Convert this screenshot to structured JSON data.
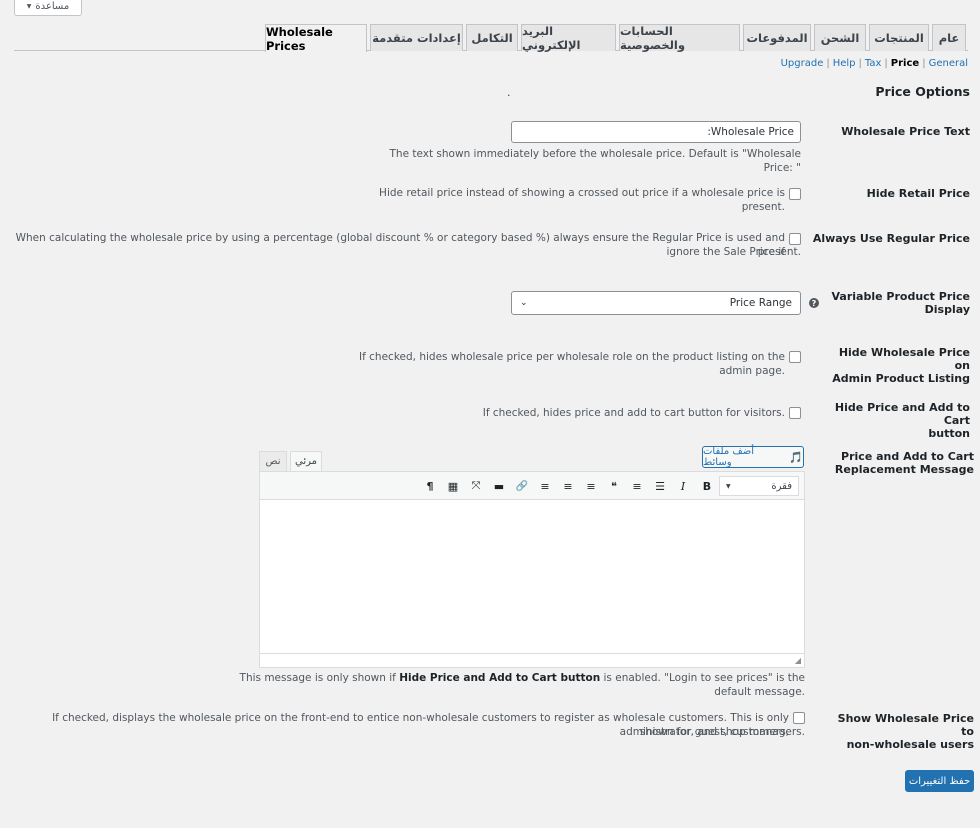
{
  "help": {
    "label": "مساعدة",
    "arrow": "▼"
  },
  "tabs": [
    {
      "label": "عام"
    },
    {
      "label": "المنتجات"
    },
    {
      "label": "الشحن"
    },
    {
      "label": "المدفوعات"
    },
    {
      "label": "الحسابات والخصوصية"
    },
    {
      "label": "البريد الإلكتروني"
    },
    {
      "label": "التكامل"
    },
    {
      "label": "إعدادات متقدمة"
    },
    {
      "label": "Wholesale Prices"
    }
  ],
  "subnav": {
    "general": "General",
    "price": "Price",
    "tax": "Tax",
    "help": "Help",
    "upgrade": "Upgrade",
    "separator": "|"
  },
  "heading": "Price Options",
  "heading_dot": ".",
  "fields": {
    "wholesale_price_text": {
      "label": "Wholesale Price Text",
      "value": "Wholesale Price:",
      "description": "The text shown immediately before the wholesale price. Default is \"Wholesale Price: \""
    },
    "hide_retail_price": {
      "label": "Hide Retail Price",
      "description": "Hide retail price instead of showing a crossed out price if a wholesale price is present."
    },
    "always_use_regular_price": {
      "label": "Always Use Regular Price",
      "description_line1": "When calculating the wholesale price by using a percentage (global discount % or category based %) always ensure the Regular Price is used and ignore the Sale Price if",
      "description_line2": "present."
    },
    "variable_product_price_display": {
      "label_line1": "Variable Product Price",
      "label_line2": "Display",
      "selected": "Price Range",
      "help_icon": "?"
    },
    "hide_wholesale_price_admin": {
      "label_line1": "Hide Wholesale Price on",
      "label_line2": "Admin Product Listing",
      "description": "If checked, hides wholesale price per wholesale role on the product listing on the admin page."
    },
    "hide_price_add_to_cart": {
      "label_line1": "Hide Price and Add to Cart",
      "label_line2": "button",
      "description": "If checked, hides price and add to cart button for visitors."
    },
    "replacement_message": {
      "label_line1": "Price and Add to Cart",
      "label_line2": "Replacement Message",
      "add_media": "أضف ملفات وسائط",
      "tab_visual": "مرئي",
      "tab_text": "نص",
      "format_select": "فقرة",
      "desc_pre": "This message is only shown if ",
      "desc_bold": "Hide Price and Add to Cart button",
      "desc_post": " is enabled. \"Login to see prices\" is the default message."
    },
    "show_wholesale_price_non_wholesale": {
      "label_line1": "Show Wholesale Price to",
      "label_line2": "non-wholesale users",
      "description_line1": "If checked, displays the wholesale price on the front-end to entice non-wholesale customers to register as wholesale customers. This is only shown for guest, customers,",
      "description_line2": "administrator, and shop managers."
    }
  },
  "save_label": "حفظ التغييرات",
  "toolbar_glyphs": {
    "bold": "B",
    "italic": "I",
    "bullets": "☰",
    "numbers": "≡",
    "quote": "❝",
    "align_left": "≡",
    "align_center": "≡",
    "align_right": "≡",
    "link": "🔗",
    "more": "▬",
    "fullscreen": "⤧",
    "kitchen_sink": "▦",
    "rtl": "¶"
  }
}
